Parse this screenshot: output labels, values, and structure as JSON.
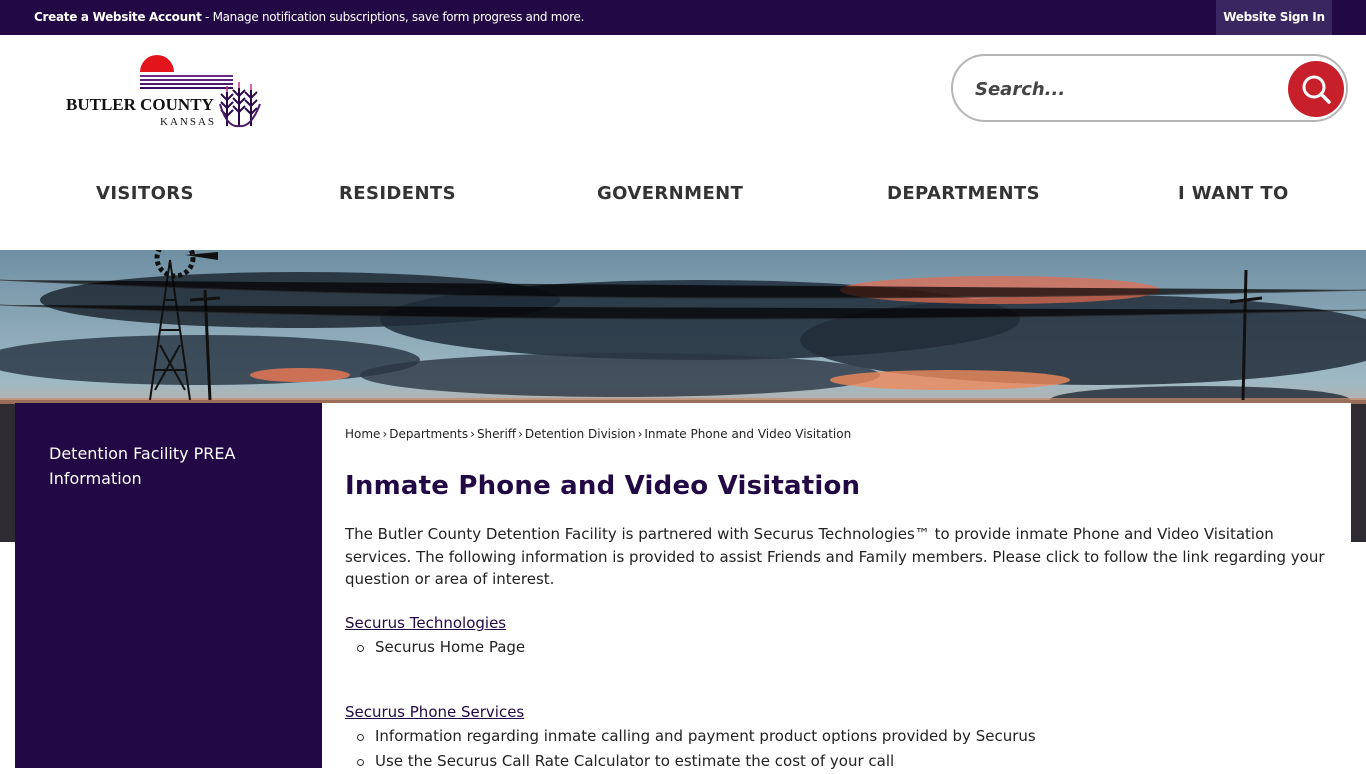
{
  "topbar": {
    "create_account": "Create a Website Account",
    "message": " - Manage notification subscriptions, save form progress and more.",
    "sign_in": "Website Sign In"
  },
  "logo": {
    "name": "BUTLER COUNTY",
    "state": "KANSAS",
    "icon": "sun-wheat-logo-icon",
    "colors": {
      "sun": "#e3141b",
      "stripes": "#4b1a6b",
      "wheat": "#2a0a4a"
    }
  },
  "search": {
    "placeholder": "Search...",
    "icon": "search-icon",
    "button_color": "#c8202b"
  },
  "nav": {
    "visitors": "VISITORS",
    "residents": "RESIDENTS",
    "government": "GOVERNMENT",
    "departments": "DEPARTMENTS",
    "i_want_to": "I WANT TO"
  },
  "sidebar": {
    "item_0": "Detention Facility PREA Information"
  },
  "breadcrumb": {
    "home": "Home",
    "departments": "Departments",
    "sheriff": "Sheriff",
    "detention": "Detention Division",
    "current": "Inmate Phone and Video Visitation",
    "separator": "›"
  },
  "page": {
    "title": "Inmate Phone and Video Visitation",
    "intro": "The Butler County Detention Facility is partnered with Securus Technologies™ to provide inmate Phone and Video Visitation services. The following information is provided to assist Friends and Family members. Please click to follow the link regarding your question or area of interest."
  },
  "sections": {
    "technologies": {
      "link": "Securus Technologies",
      "items": [
        "Securus Home Page"
      ]
    },
    "phone": {
      "link": "Securus Phone Services",
      "items": [
        "Information regarding inmate calling and payment product options provided by Securus",
        "Use the Securus Call Rate Calculator to estimate the cost of your call"
      ]
    }
  },
  "colors": {
    "brand_purple": "#220845",
    "accent_red": "#c8202b"
  }
}
